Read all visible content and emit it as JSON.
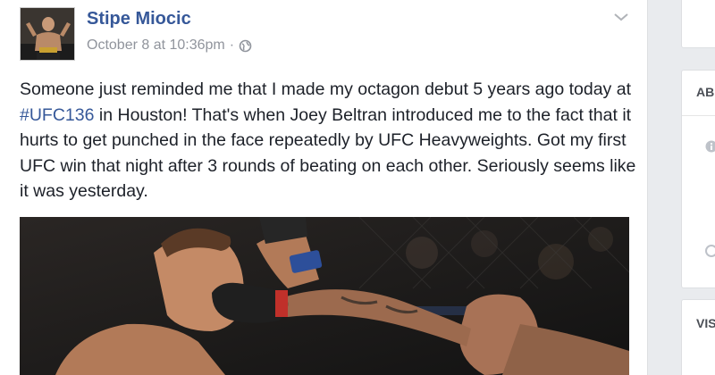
{
  "post": {
    "author": "Stipe Miocic",
    "timestamp": "October 8 at 10:36pm",
    "meta_separator": "·",
    "text_before": "Someone just reminded me that I made my octagon debut 5 years ago today at ",
    "hashtag": "#UFC136",
    "text_after": " in Houston! That's when Joey Beltran introduced me to the fact that it hurts to get punched in the face repeatedly by UFC Heavyweights. Got my first UFC win that night after 3 rounds of beating on each other. Seriously seems like it was yesterday.",
    "privacy_icon": "globe-icon",
    "options_icon": "chevron-down-icon"
  },
  "sidebar": {
    "about_title": "AB",
    "visitors_title": "VIS",
    "info_icon": "info-icon"
  },
  "colors": {
    "link": "#365899",
    "text": "#1d2129",
    "meta": "#90949c",
    "background": "#e9ebee"
  }
}
